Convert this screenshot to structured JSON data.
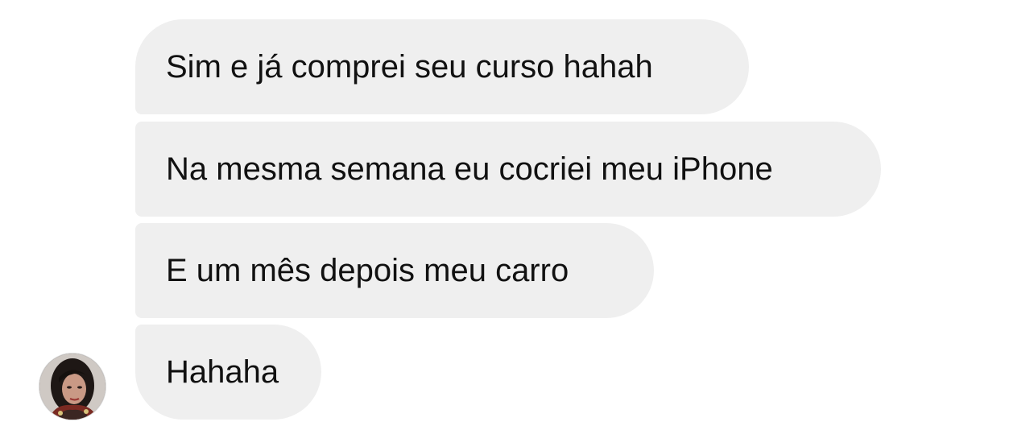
{
  "messages": [
    {
      "text": "Sim e já comprei seu curso hahah"
    },
    {
      "text": "Na mesma semana eu cocriei meu iPhone"
    },
    {
      "text": "E um mês depois meu carro"
    },
    {
      "text": "Hahaha"
    }
  ],
  "avatar": {
    "icon": "user-profile-photo"
  },
  "colors": {
    "bubble_background": "#efefef",
    "text": "#111111",
    "page_background": "#ffffff"
  }
}
